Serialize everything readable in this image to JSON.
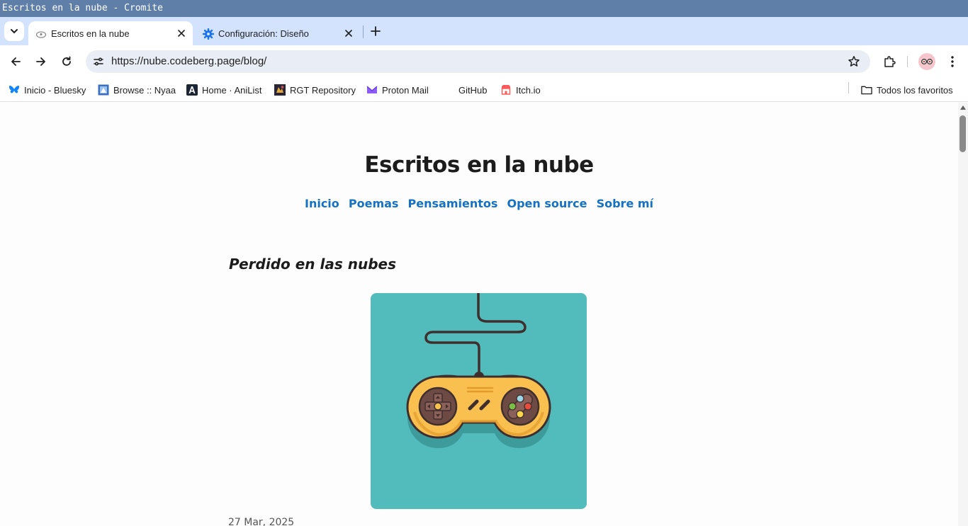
{
  "window": {
    "title": "Escritos en la nube - Cromite"
  },
  "tabs": [
    {
      "label": "Escritos en la nube",
      "active": true,
      "icon": "cloud-icon"
    },
    {
      "label": "Configuración: Diseño",
      "active": false,
      "icon": "gear-icon"
    }
  ],
  "toolbar": {
    "url": "https://nube.codeberg.page/blog/"
  },
  "bookmarks": [
    {
      "label": "Inicio - Bluesky",
      "icon": "bluesky-butterfly-icon"
    },
    {
      "label": "Browse :: Nyaa",
      "icon": "nyaa-icon"
    },
    {
      "label": "Home · AniList",
      "icon": "anilist-icon"
    },
    {
      "label": "RGT Repository",
      "icon": "rgt-icon"
    },
    {
      "label": "Proton Mail",
      "icon": "proton-mail-icon"
    },
    {
      "label": "GitHub",
      "icon": "github-icon"
    },
    {
      "label": "Itch.io",
      "icon": "itchio-icon"
    }
  ],
  "all_bookmarks_label": "Todos los favoritos",
  "page": {
    "site_title": "Escritos en la nube",
    "nav": [
      "Inicio",
      "Poemas",
      "Pensamientos",
      "Open source",
      "Sobre mí"
    ],
    "post": {
      "title": "Perdido en las nubes",
      "date": "27 Mar, 2025",
      "image": "gamepad-illustration"
    }
  },
  "colors": {
    "titlebar": "#5f7fa8",
    "tabstrip": "#d3e3fd",
    "link": "#1571c2",
    "image_background": "#52bcbc",
    "controller_body": "#f9c04f"
  }
}
